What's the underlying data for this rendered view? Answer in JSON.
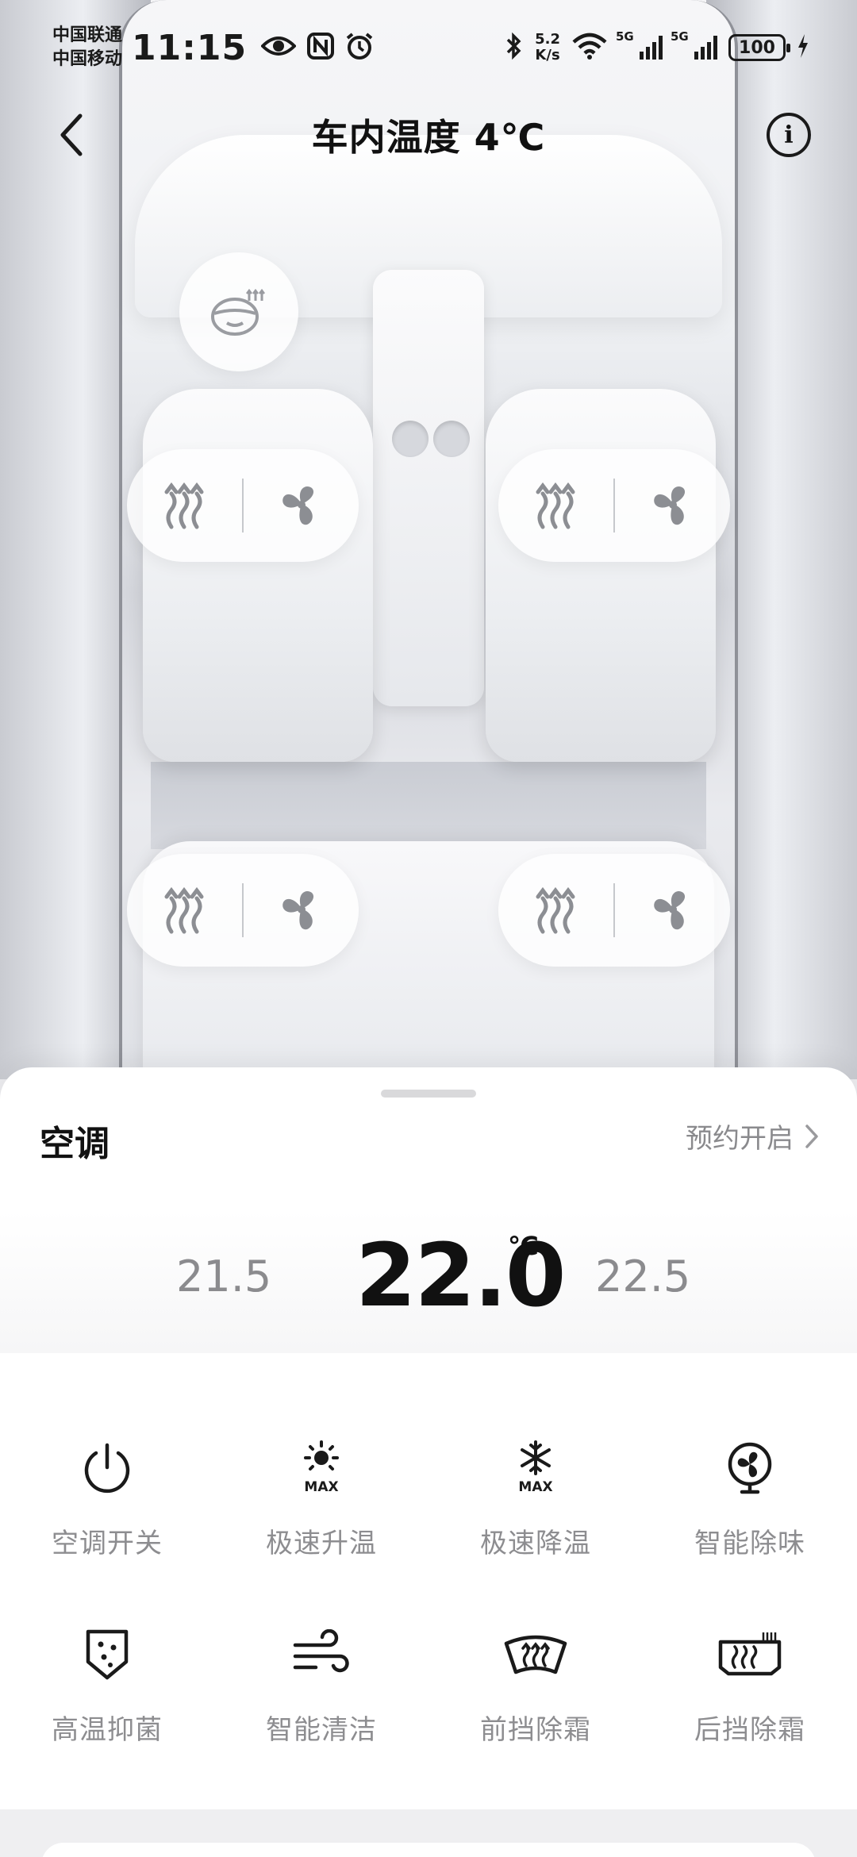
{
  "status_bar": {
    "carrier_1": "中国联通",
    "carrier_2": "中国移动",
    "time": "11:15",
    "net_speed_value": "5.2",
    "net_speed_unit": "K/s",
    "signal_1_tag": "5G",
    "signal_2_tag": "5G",
    "battery": "100"
  },
  "nav": {
    "title": "车内温度 4℃"
  },
  "sheet": {
    "title": "空调",
    "schedule_label": "预约开启",
    "temperature": {
      "prev": "21.5",
      "current": "22.0",
      "unit": "℃",
      "next": "22.5"
    },
    "functions": [
      {
        "label": "空调开关",
        "icon": "power-icon"
      },
      {
        "label": "极速升温",
        "icon": "max-heat-icon"
      },
      {
        "label": "极速降温",
        "icon": "max-cool-icon"
      },
      {
        "label": "智能除味",
        "icon": "fan-icon"
      },
      {
        "label": "高温抑菌",
        "icon": "sterilize-icon"
      },
      {
        "label": "智能清洁",
        "icon": "wind-clean-icon"
      },
      {
        "label": "前挡除霜",
        "icon": "front-defrost-icon"
      },
      {
        "label": "后挡除霜",
        "icon": "rear-defrost-icon"
      }
    ],
    "max_badge": "MAX"
  },
  "colors": {
    "icon": "#1a1a1a",
    "label_gray": "#8d8d90",
    "pill_icon": "#8c8e93"
  }
}
